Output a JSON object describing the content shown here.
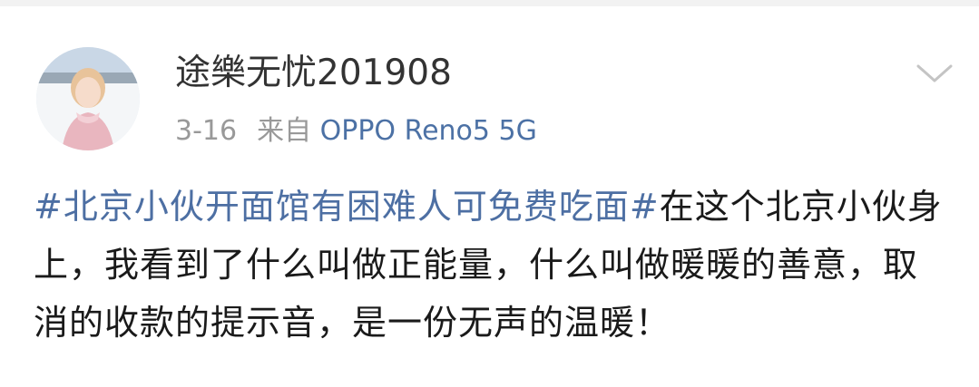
{
  "post": {
    "author": {
      "name": "途樂无忧201908",
      "avatar": "avatar-photo"
    },
    "date": "3-16",
    "source_label": "来自",
    "device": "OPPO Reno5 5G",
    "hashtag": "#北京小伙开面馆有困难人可免费吃面#",
    "body": "在这个北京小伙身上，我看到了什么叫做正能量，什么叫做暖暖的善意，取消的收款的提示音，是一份无声的温暖！",
    "menu_icon": "chevron-down-icon"
  },
  "colors": {
    "username": "#333333",
    "meta": "#999999",
    "link": "#4d6fa3",
    "body_text": "#1a1a1a"
  }
}
